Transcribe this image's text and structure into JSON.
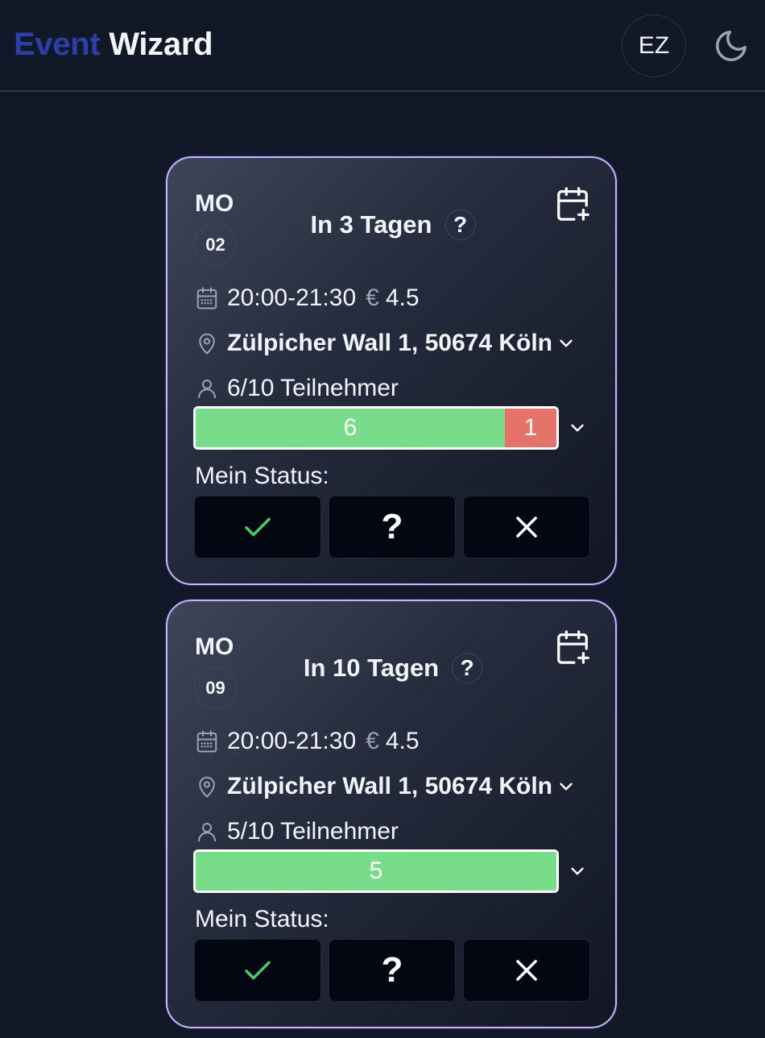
{
  "header": {
    "brand_part1": "Event",
    "brand_part2": "Wizard",
    "avatar_initials": "EZ",
    "theme_icon": "moon-icon"
  },
  "colors": {
    "brand_blue": "#2d3fa6",
    "card_border": "#c4b5fd",
    "confirmed": "#79dc8b",
    "declined": "#e5736c",
    "check": "#4ec76a"
  },
  "events": [
    {
      "weekday": "MO",
      "day": "02",
      "relative": "In 3 Tagen",
      "time": "20:00-21:30",
      "price": "4.5",
      "location": "Zülpicher Wall 1, 50674 Köln",
      "participants": "6/10 Teilnehmer",
      "bar": {
        "max": 10,
        "confirmed": 6,
        "declined": 1,
        "confirmed_label": "6",
        "declined_label": "1"
      },
      "status_label": "Mein Status:"
    },
    {
      "weekday": "MO",
      "day": "09",
      "relative": "In 10 Tagen",
      "time": "20:00-21:30",
      "price": "4.5",
      "location": "Zülpicher Wall 1, 50674 Köln",
      "participants": "5/10 Teilnehmer",
      "bar": {
        "max": 10,
        "confirmed": 5,
        "declined": 0,
        "confirmed_label": "5",
        "declined_label": ""
      },
      "status_label": "Mein Status:"
    }
  ]
}
